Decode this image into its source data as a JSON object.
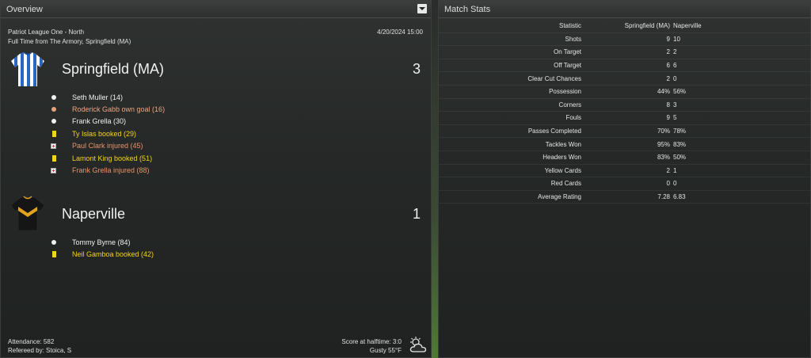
{
  "overview": {
    "header": "Overview",
    "competition": "Patriot League One - North",
    "datetime": "4/20/2024 15:00",
    "venue_line": "Full Time from The Armory, Springfield (MA)",
    "home": {
      "name": "Springfield (MA)",
      "score": "3",
      "kit_colors": {
        "primary": "#2a66c4",
        "secondary": "#ffffff"
      },
      "events": [
        {
          "type": "goal",
          "text": "Seth Muller (14)",
          "color": "#f0f0f0"
        },
        {
          "type": "own-goal",
          "text": "Roderick Gabb own goal (16)",
          "color": "#e8946b"
        },
        {
          "type": "goal",
          "text": "Frank Grella (30)",
          "color": "#f0f0f0"
        },
        {
          "type": "yellow-card",
          "text": "Ty Islas booked (29)",
          "color": "#f2d41c"
        },
        {
          "type": "injury",
          "text": "Paul Clark injured (45)",
          "color": "#e8946b"
        },
        {
          "type": "yellow-card",
          "text": "Lamont King booked (51)",
          "color": "#f2d41c"
        },
        {
          "type": "injury",
          "text": "Frank Grella injured (88)",
          "color": "#e8946b"
        }
      ]
    },
    "away": {
      "name": "Naperville",
      "score": "1",
      "kit_colors": {
        "primary": "#151515",
        "secondary": "#e0a21f"
      },
      "events": [
        {
          "type": "goal",
          "text": "Tommy Byrne (84)",
          "color": "#f0f0f0"
        },
        {
          "type": "yellow-card",
          "text": "Neil Gamboa booked (42)",
          "color": "#f2d41c"
        }
      ]
    },
    "attendance": "Attendance: 582",
    "referee": "Refereed by: Stoica, S",
    "halftime": "Score at halftime: 3:0",
    "weather": "Gusty 55°F",
    "weather_icon": "cloud-sun-icon"
  },
  "match_stats": {
    "header": "Match Stats",
    "columns": {
      "label": "Statistic",
      "home": "Springfield (MA)",
      "away": "Naperville"
    },
    "rows": [
      {
        "label": "Shots",
        "home": "9",
        "away": "10"
      },
      {
        "label": "On Target",
        "home": "2",
        "away": "2"
      },
      {
        "label": "Off Target",
        "home": "6",
        "away": "6"
      },
      {
        "label": "Clear Cut Chances",
        "home": "2",
        "away": "0"
      },
      {
        "label": "Possession",
        "home": "44%",
        "away": "56%"
      },
      {
        "label": "Corners",
        "home": "8",
        "away": "3"
      },
      {
        "label": "Fouls",
        "home": "9",
        "away": "5"
      },
      {
        "label": "Passes Completed",
        "home": "70%",
        "away": "78%"
      },
      {
        "label": "Tackles Won",
        "home": "95%",
        "away": "83%"
      },
      {
        "label": "Headers Won",
        "home": "83%",
        "away": "50%"
      },
      {
        "label": "Yellow Cards",
        "home": "2",
        "away": "1"
      },
      {
        "label": "Red Cards",
        "home": "0",
        "away": "0"
      },
      {
        "label": "Average Rating",
        "home": "7.28",
        "away": "6.83"
      }
    ]
  }
}
